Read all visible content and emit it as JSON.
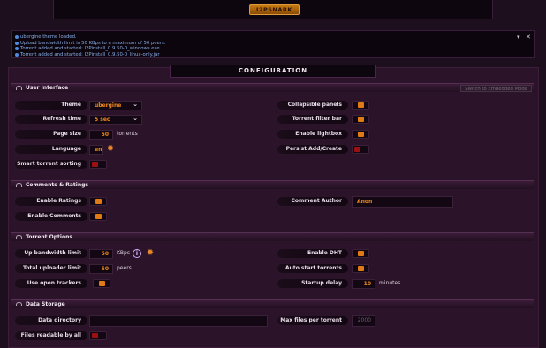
{
  "logo": "I2PSNARK",
  "messages": [
    "ubergine theme loaded.",
    "Upload bandwidth limit is 50 KBps to a maximum of 50 peers.",
    "Torrent added and started: I2Pinstall_0.9.50-0_windows.exe",
    "Torrent added and started: I2Pinstall_0.9.50-0_linux-only.jar"
  ],
  "config_title": "CONFIGURATION",
  "sections": {
    "ui": "User Interface",
    "comments": "Comments & Ratings",
    "torrent": "Torrent Options",
    "storage": "Data Storage"
  },
  "embed_button": "Switch to Embedded Mode",
  "labels": {
    "theme": "Theme",
    "refresh": "Refresh time",
    "pagesize": "Page size",
    "language": "Language",
    "smartsort": "Smart torrent sorting",
    "collapsible": "Collapsible panels",
    "filterbar": "Torrent filter bar",
    "lightbox": "Enable lightbox",
    "persist": "Persist Add/Create",
    "enable_ratings": "Enable Ratings",
    "enable_comments": "Enable Comments",
    "comment_author": "Comment Author",
    "up_bw": "Up bandwidth limit",
    "total_up": "Total uploader limit",
    "open_trackers": "Use open trackers",
    "dht": "Enable DHT",
    "autostart": "Auto start torrents",
    "startup_delay": "Startup delay",
    "data_dir": "Data directory",
    "max_files": "Max files per torrent",
    "readable": "Files readable by all"
  },
  "values": {
    "theme": "ubergine",
    "refresh": "5 sec",
    "pagesize": "50",
    "pagesize_suffix": "torrents",
    "language": "en",
    "author": "Anon",
    "up_bw": "50",
    "up_bw_suffix": "KBps",
    "total_up": "50",
    "total_up_suffix": "peers",
    "startup_delay": "10",
    "startup_suffix": "minutes",
    "data_dir": "",
    "max_files_placeholder": "2000"
  },
  "toggles": {
    "smartsort": false,
    "collapsible": true,
    "filterbar": true,
    "lightbox": true,
    "persist": false,
    "enable_ratings": true,
    "enable_comments": true,
    "open_trackers": true,
    "dht": true,
    "autostart": true,
    "readable": false
  },
  "colors": {
    "accent": "#e07a15",
    "toggle_off": "#9b1010",
    "message": "#88aee8"
  }
}
